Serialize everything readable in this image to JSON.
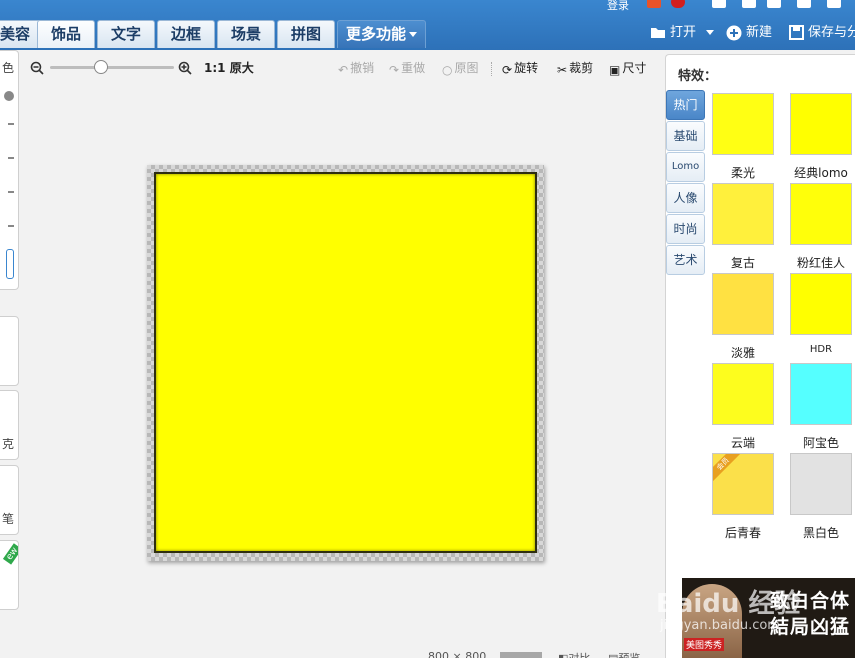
{
  "header": {
    "login_label": "登录",
    "tabs": [
      {
        "label": "美容",
        "active": false
      },
      {
        "label": "饰品",
        "active": true
      },
      {
        "label": "文字",
        "active": false
      },
      {
        "label": "边框",
        "active": false
      },
      {
        "label": "场景",
        "active": false
      },
      {
        "label": "拼图",
        "active": false
      }
    ],
    "more_label": "更多功能",
    "open_label": "打开",
    "new_label": "新建",
    "save_label": "保存与分"
  },
  "left_panel": {
    "card_labels": [
      "色",
      "克",
      "笔"
    ],
    "new_badge": "ew"
  },
  "toolbar": {
    "zoom_ratio": "1:1",
    "original_size": "原大",
    "undo": "撤销",
    "redo": "重做",
    "original": "原图",
    "rotate": "旋转",
    "crop": "裁剪",
    "size": "尺寸"
  },
  "canvas": {
    "image_color": "#ffff00"
  },
  "status_bar": {
    "dimensions": "800 × 800",
    "compare": "对比",
    "preview": "预览"
  },
  "effects_panel": {
    "title": "特效：",
    "categories": [
      "热门",
      "基础",
      "Lomo",
      "人像",
      "时尚",
      "艺术"
    ],
    "active_category": "热门",
    "items": [
      {
        "label": "柔光",
        "color": "#ffff14"
      },
      {
        "label": "经典lomo",
        "color": "#ffff00"
      },
      {
        "label": "复古",
        "color": "#fff03c"
      },
      {
        "label": "粉红佳人",
        "color": "#ffff0a"
      },
      {
        "label": "淡雅",
        "color": "#ffe142"
      },
      {
        "label": "HDR",
        "color": "#ffff00"
      },
      {
        "label": "云端",
        "color": "#fdfd1e"
      },
      {
        "label": "阿宝色",
        "color": "#55ffff"
      },
      {
        "label": "后青春",
        "color": "#fbe04a",
        "badge": "会员"
      },
      {
        "label": "黑白色",
        "color": "#e2e2e2"
      }
    ]
  },
  "ad": {
    "line1": "致白合体",
    "line2": "結局凶猛",
    "logo": "美图秀秀"
  },
  "watermark": {
    "main": "Baidu 经验",
    "sub": "jingyan.baidu.com"
  }
}
